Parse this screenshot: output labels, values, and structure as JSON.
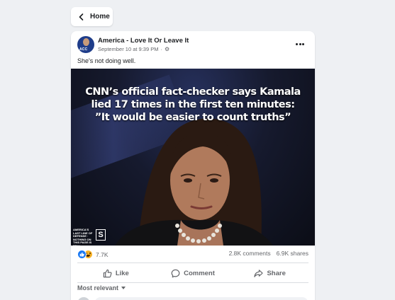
{
  "nav": {
    "home_label": "Home"
  },
  "post": {
    "page_name": "America - Love It Or Leave It",
    "date": "September 10 at 9:39 PM",
    "separator": "·",
    "caption": "She's not doing well.",
    "image_text": {
      "line1": "CNN’s official fact-checker says Kamala",
      "line2": "lied 17 times in the first ten minutes:",
      "line3": "”It would be easier to count truths”"
    },
    "badge": {
      "text": "AMERICA'S LAST LINE OF DEFENSE · NOTHING ON THIS PAGE IS REAL",
      "logo": "S"
    }
  },
  "stats": {
    "reactions": "7.7K",
    "comments": "2.8K comments",
    "shares": "6.9K shares"
  },
  "actions": {
    "like": "Like",
    "comment": "Comment",
    "share": "Share"
  },
  "comments": {
    "sort_label": "Most relevant"
  },
  "icons": {
    "back": "chevron-left-icon",
    "more": "more-horizontal-icon",
    "privacy": "gear-icon",
    "like": "thumbs-up-icon",
    "comment": "speech-bubble-icon",
    "share": "share-arrow-icon"
  },
  "colors": {
    "background": "#eef0f3",
    "card": "#ffffff",
    "like_blue": "#1877f2",
    "haha_yellow": "#f7b125",
    "secondary_text": "#65676b"
  }
}
